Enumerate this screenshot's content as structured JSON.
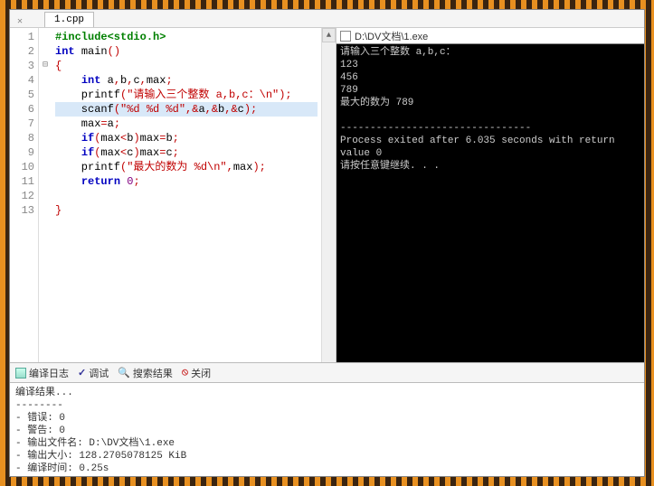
{
  "tab": {
    "filename": "1.cpp"
  },
  "editor": {
    "highlighted_line_index": 5,
    "lines": [
      {
        "n": 1,
        "html": "<span class='pp'>#include&lt;stdio.h&gt;</span>"
      },
      {
        "n": 2,
        "html": "<span class='kw'>int</span> <span class='fn'>main</span><span class='op'>()</span>"
      },
      {
        "n": 3,
        "fold": "⊟",
        "html": "<span class='op'>{</span>"
      },
      {
        "n": 4,
        "html": "    <span class='kw'>int</span> a<span class='op'>,</span>b<span class='op'>,</span>c<span class='op'>,</span>max<span class='op'>;</span>"
      },
      {
        "n": 5,
        "html": "    printf<span class='op'>(</span><span class='str'>\"请输入三个整数 a,b,c：\\n\"</span><span class='op'>);</span>"
      },
      {
        "n": 6,
        "html": "    scanf<span class='op'>(</span><span class='str'>\"%d %d %d\"</span><span class='op'>,&amp;</span>a<span class='op'>,&amp;</span>b<span class='op'>,&amp;</span>c<span class='op'>);</span>"
      },
      {
        "n": 7,
        "html": "    max<span class='op'>=</span>a<span class='op'>;</span>"
      },
      {
        "n": 8,
        "html": "    <span class='kw'>if</span><span class='op'>(</span>max<span class='op'>&lt;</span>b<span class='op'>)</span>max<span class='op'>=</span>b<span class='op'>;</span>"
      },
      {
        "n": 9,
        "html": "    <span class='kw'>if</span><span class='op'>(</span>max<span class='op'>&lt;</span>c<span class='op'>)</span>max<span class='op'>=</span>c<span class='op'>;</span>"
      },
      {
        "n": 10,
        "html": "    printf<span class='op'>(</span><span class='str'>\"最大的数为 %d\\n\"</span><span class='op'>,</span>max<span class='op'>);</span>"
      },
      {
        "n": 11,
        "html": "    <span class='kw'>return</span> <span class='num'>0</span><span class='op'>;</span>"
      },
      {
        "n": 12,
        "html": ""
      },
      {
        "n": 13,
        "html": "<span class='op'>}</span>"
      }
    ]
  },
  "console": {
    "title": "D:\\DV文档\\1.exe",
    "text": "请输入三个整数 a,b,c：\n123\n456\n789\n最大的数为 789\n\n--------------------------------\nProcess exited after 6.035 seconds with return value 0\n请按任意键继续. . ."
  },
  "bottom_tabs": {
    "compile_log": "编译日志",
    "debug": "调试",
    "search_results": "搜索结果",
    "close": "关闭"
  },
  "output": {
    "header": "编译结果...",
    "sep": "--------",
    "lines": [
      "- 错误: 0",
      "- 警告: 0",
      "- 输出文件名: D:\\DV文档\\1.exe",
      "- 输出大小: 128.2705078125 KiB",
      "- 编译时间: 0.25s"
    ]
  }
}
